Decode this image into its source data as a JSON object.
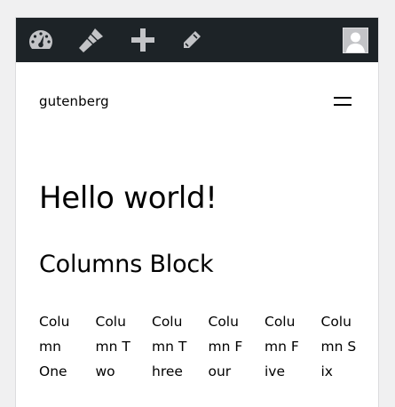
{
  "admin_bar": {
    "items": [
      {
        "name": "dashboard",
        "icon": "dashboard-gauge-icon"
      },
      {
        "name": "customize",
        "icon": "paintbrush-icon"
      },
      {
        "name": "new-content",
        "icon": "plus-icon"
      },
      {
        "name": "edit-post",
        "icon": "pencil-icon"
      },
      {
        "name": "user-account",
        "icon": "avatar-icon"
      }
    ],
    "background": "#1d2327",
    "icon_color": "#c3c4c7"
  },
  "site": {
    "title": "gutenberg",
    "menu_icon": "hamburger-menu-icon"
  },
  "post": {
    "title": "Hello world!",
    "block_heading": "Columns Block",
    "columns": [
      "Column One",
      "Column Two",
      "Column Three",
      "Column Four",
      "Column Five",
      "Column Six"
    ]
  }
}
